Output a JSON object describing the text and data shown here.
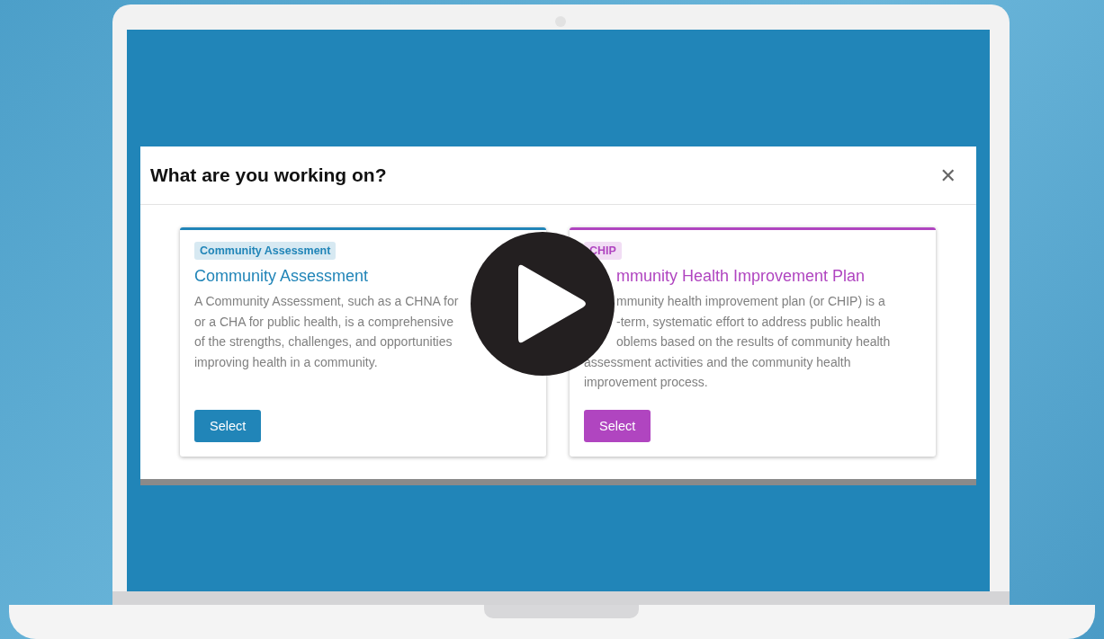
{
  "dialog": {
    "title": "What are you working on?",
    "close_label": "✕"
  },
  "cards": [
    {
      "tag": "Community Assessment",
      "title": {
        "kind": "whole",
        "text": "Community Assessment"
      },
      "lines": [
        {
          "kind": "whole",
          "text": "A Community Assessment, such as a CHNA for"
        },
        {
          "kind": "whole",
          "text": "or a CHA for public health, is a comprehensive"
        },
        {
          "kind": "whole",
          "text": "of the strengths, challenges, and opportunities"
        },
        {
          "kind": "whole",
          "text": "improving health in a community."
        }
      ],
      "button": "Select",
      "color": "#2185b8"
    },
    {
      "tag": "CHIP",
      "title": {
        "kind": "clipped",
        "text": "mmunity Health Improvement Plan"
      },
      "lines": [
        {
          "kind": "clipped",
          "text": "mmunity health improvement plan (or CHIP) is a"
        },
        {
          "kind": "clipped",
          "text": "-term, systematic effort to address public health"
        },
        {
          "kind": "clipped",
          "text": "oblems based on the results of community health"
        },
        {
          "kind": "whole",
          "text": "assessment activities and the community health"
        },
        {
          "kind": "whole",
          "text": "improvement process."
        }
      ],
      "button": "Select",
      "color": "#b045c0"
    }
  ]
}
